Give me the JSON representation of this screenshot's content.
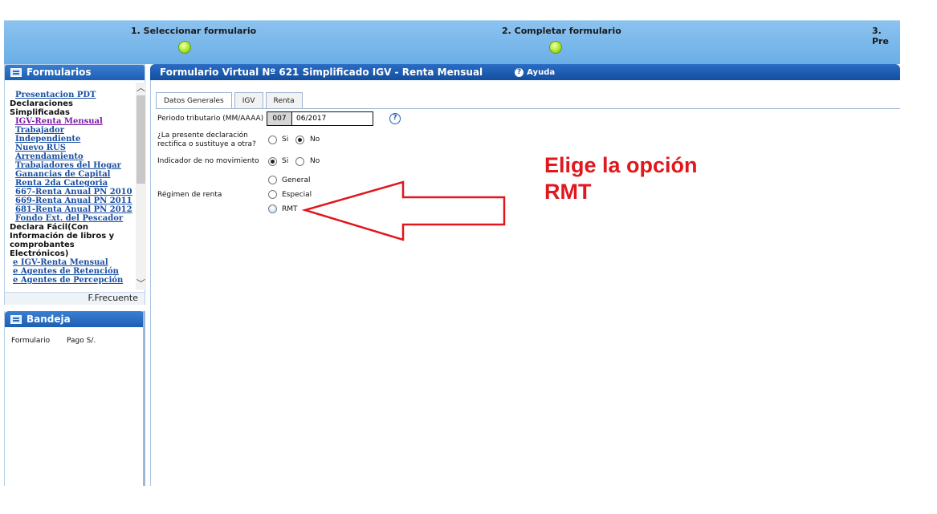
{
  "wizard": {
    "steps": [
      {
        "label": "1. Seleccionar formulario"
      },
      {
        "label": "2. Completar formulario"
      },
      {
        "label": "3. Pre"
      }
    ]
  },
  "sidebar": {
    "forms_title": "Formularios",
    "groups": [
      {
        "label": "",
        "items": [
          {
            "label": "Presentacion PDT"
          }
        ]
      },
      {
        "label": "Declaraciones Simplificadas",
        "items": [
          {
            "label": "IGV-Renta Mensual",
            "visited": true
          },
          {
            "label": "Trabajador"
          },
          {
            "label": "Independiente"
          },
          {
            "label": "Nuevo RUS"
          },
          {
            "label": "Arrendamiento"
          },
          {
            "label": "Trabajadores del Hogar"
          },
          {
            "label": "Ganancias de Capital"
          },
          {
            "label": "Renta 2da Categoria"
          },
          {
            "label": "667-Renta Anual PN 2010"
          },
          {
            "label": "669-Renta Anual PN 2011"
          },
          {
            "label": "681-Renta Anual PN 2012"
          },
          {
            "label": "Fondo Ext. del Pescador"
          }
        ]
      },
      {
        "label": "Declara Fácil(Con Información de libros y comprobantes Electrónicos)",
        "items": [
          {
            "label": "e IGV-Renta Mensual"
          },
          {
            "label": "e Agentes de Retención"
          },
          {
            "label": "e Agentes de Percepción"
          }
        ]
      }
    ],
    "frecuente_label": "F.Frecuente",
    "bandeja_title": "Bandeja",
    "bandeja_columns": [
      "Formulario",
      "Pago S/."
    ]
  },
  "main": {
    "title": "Formulario Virtual Nº 621 Simplificado IGV - Renta Mensual",
    "help_label": "Ayuda",
    "tabs": [
      {
        "label": "Datos Generales",
        "active": true
      },
      {
        "label": "IGV"
      },
      {
        "label": "Renta"
      }
    ],
    "periodo": {
      "label": "Periodo tributario (MM/AAAA)",
      "code": "007",
      "value": "06/2017"
    },
    "rectifica": {
      "label_line1": "¿La presente declaración",
      "label_line2": "rectifica o sustituye a otra?",
      "options": [
        {
          "label": "Si",
          "checked": false
        },
        {
          "label": "No",
          "checked": true
        }
      ]
    },
    "no_movimiento": {
      "label": "Indicador de no movimiento",
      "options": [
        {
          "label": "Si",
          "checked": true
        },
        {
          "label": "No",
          "checked": false
        }
      ]
    },
    "regimen": {
      "label": "Régimen de renta",
      "options": [
        {
          "label": "General",
          "checked": false
        },
        {
          "label": "Especial",
          "checked": false
        },
        {
          "label": "RMT",
          "checked": false
        }
      ]
    }
  },
  "annotation": {
    "line1": "Elige la opción",
    "line2": "RMT",
    "color": "#e0171d"
  },
  "colors": {
    "header_blue": "#1d5fb4",
    "wizard_blue": "#7bb8ea",
    "link_blue": "#1a4fa1",
    "visited_link": "#7b1da6"
  }
}
